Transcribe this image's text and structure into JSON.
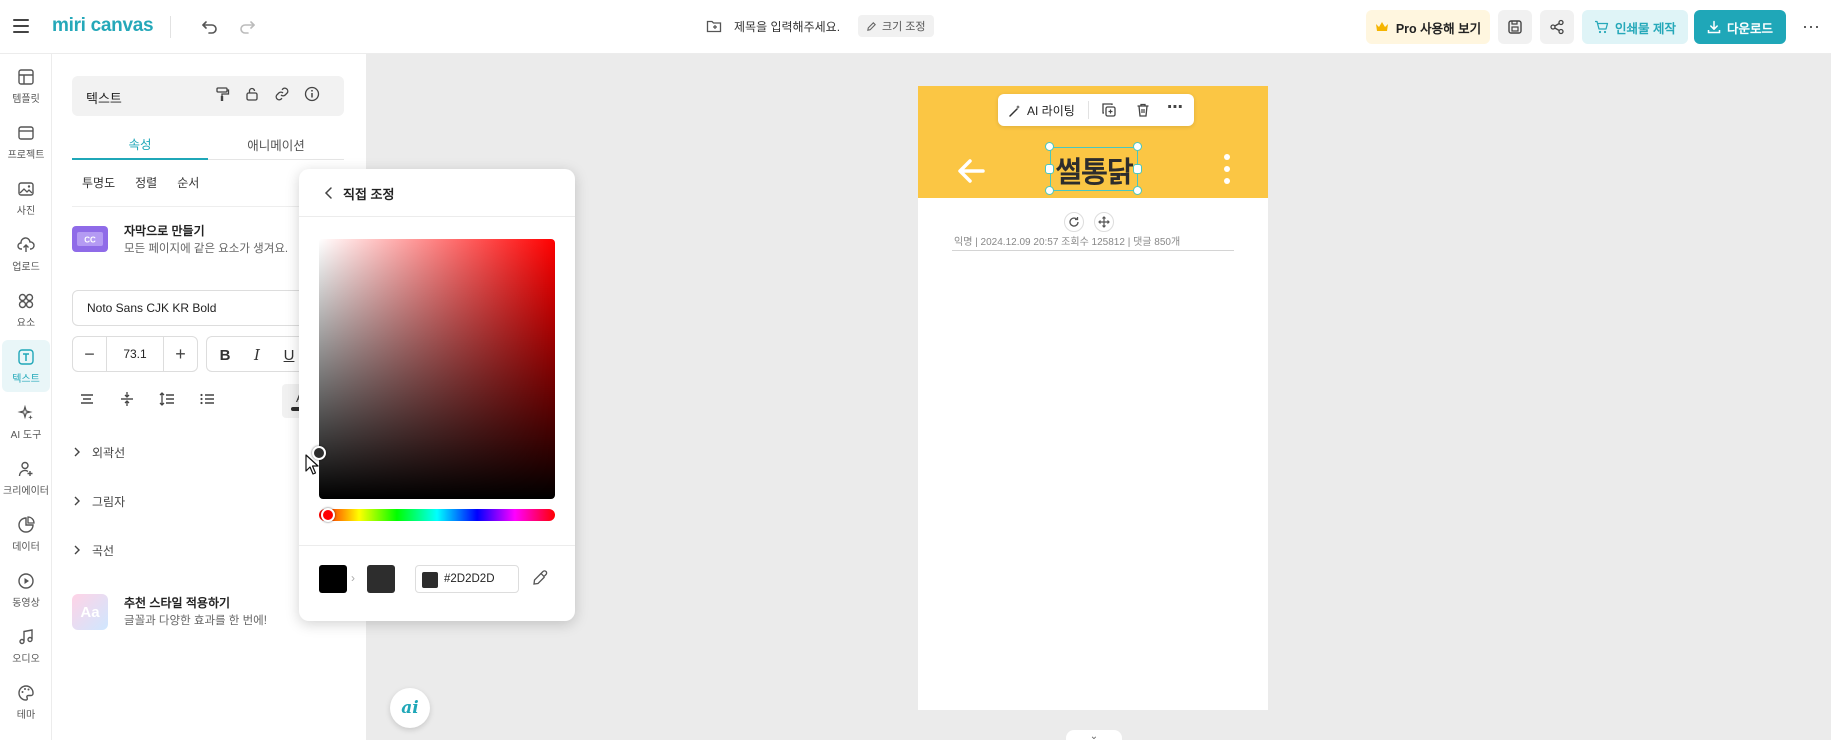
{
  "header": {
    "logo_text": "miri canvas",
    "document_title": "제목을 입력해주세요.",
    "resize_label": "크기 조정",
    "pro_label": "Pro 사용해 보기",
    "print_label": "인쇄물 제작",
    "download_label": "다운로드",
    "more_label": "···",
    "brand_color": "#1fa7b8"
  },
  "rail": {
    "items": [
      {
        "label": "템플릿",
        "icon": "template-icon"
      },
      {
        "label": "프로젝트",
        "icon": "folder-icon"
      },
      {
        "label": "사진",
        "icon": "photo-icon"
      },
      {
        "label": "업로드",
        "icon": "upload-icon"
      },
      {
        "label": "요소",
        "icon": "elements-icon"
      },
      {
        "label": "텍스트",
        "icon": "text-icon",
        "active": true
      },
      {
        "label": "AI 도구",
        "icon": "ai-sparkle-icon"
      },
      {
        "label": "크리에이터",
        "icon": "creator-icon"
      },
      {
        "label": "데이터",
        "icon": "chart-icon"
      },
      {
        "label": "동영상",
        "icon": "video-icon"
      },
      {
        "label": "오디오",
        "icon": "music-icon"
      },
      {
        "label": "테마",
        "icon": "palette-icon"
      }
    ]
  },
  "panel": {
    "element_name": "텍스트",
    "tabs": [
      "속성",
      "애니메이션"
    ],
    "subtabs": [
      "투명도",
      "정렬",
      "순서"
    ],
    "caption": {
      "title": "자막으로 만들기",
      "desc": "모든 페이지에 같은 요소가 생겨요."
    },
    "font_family": "Noto Sans CJK KR Bold",
    "font_size": "73.1",
    "style_buttons": {
      "bold": "B",
      "italic": "I",
      "underline": "U"
    },
    "text_color_glyph": "A",
    "accordions": [
      "외곽선",
      "그림자",
      "곡선"
    ],
    "recommend": {
      "title": "추천 스타일 적용하기",
      "desc": "글꼴과 다양한 효과를 한 번에!",
      "icon_text": "Aa"
    }
  },
  "canvas": {
    "headline": "썰통닭",
    "ai_writing_label": "AI 라이팅",
    "meta_text": "익명  |  2024.12.09 20:57       조회수 125812  |  댓글 850개",
    "header_color": "#fbc644",
    "ai_fab_label": "ai",
    "bottom_tab_label": "⌄"
  },
  "color_picker": {
    "title": "직접 조정",
    "previous_color": "#000000",
    "current_color": "#2D2D2D",
    "hex_value": "#2D2D2D",
    "hue_color": "#ff0000"
  }
}
